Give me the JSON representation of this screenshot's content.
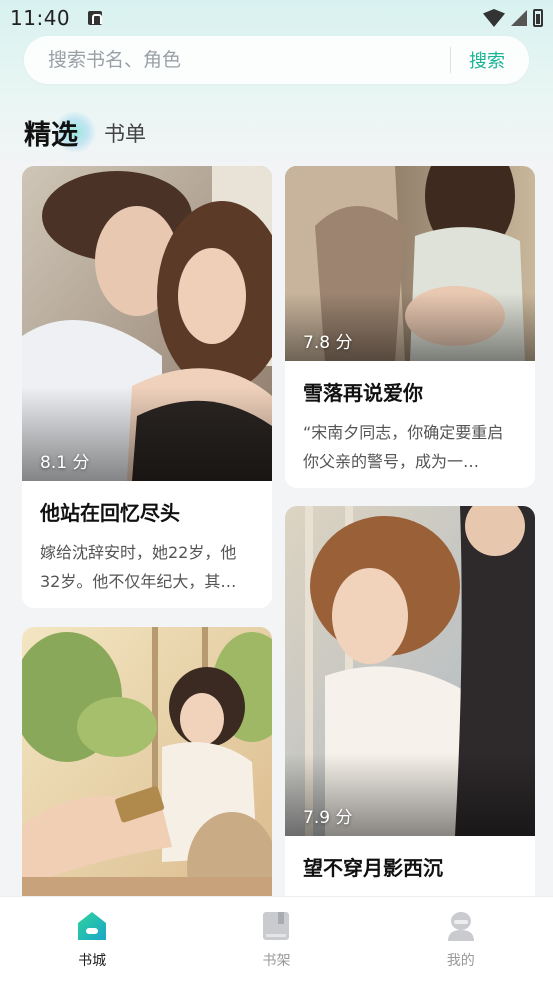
{
  "status_bar": {
    "time": "11:40"
  },
  "search": {
    "placeholder": "搜索书名、角色",
    "button_label": "搜索"
  },
  "tabs": [
    {
      "label": "精选",
      "active": true
    },
    {
      "label": "书单",
      "active": false
    }
  ],
  "books": [
    {
      "score": "8.1 分",
      "title": "他站在回忆尽头",
      "description": "嫁给沈辞安时，她22岁，他32岁。他不仅年纪大，其…"
    },
    {
      "score": "7.8 分",
      "title": "雪落再说爱你",
      "description": "“宋南夕同志，你确定要重启你父亲的警号，成为一…"
    },
    {
      "score": "",
      "title": "",
      "description": ""
    },
    {
      "score": "7.9 分",
      "title": "望不穿月影西沉",
      "description": ""
    }
  ],
  "bottom_nav": [
    {
      "label": "书城",
      "icon": "bookstore-icon",
      "active": true
    },
    {
      "label": "书架",
      "icon": "bookshelf-icon",
      "active": false
    },
    {
      "label": "我的",
      "icon": "profile-icon",
      "active": false
    }
  ],
  "colors": {
    "accent": "#1ab394",
    "background": "#f3f4f6"
  }
}
